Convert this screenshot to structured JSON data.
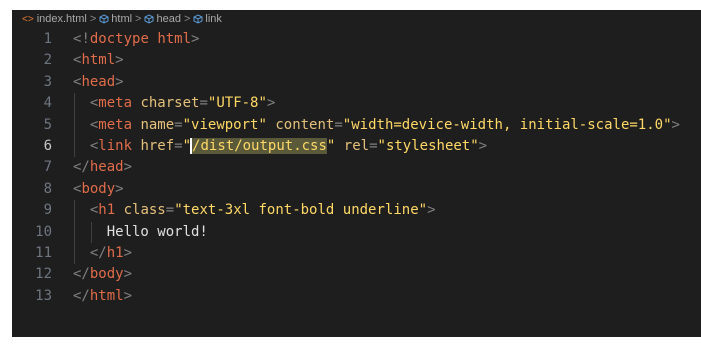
{
  "breadcrumb": {
    "items": [
      "index.html",
      "html",
      "head",
      "link"
    ],
    "separator": ">"
  },
  "editor": {
    "active_line": 6,
    "lines": [
      {
        "n": "1",
        "tokens": [
          [
            "pun",
            "<"
          ],
          [
            "pun",
            "!"
          ],
          [
            "tagname",
            "doctype"
          ],
          [
            "txt",
            " "
          ],
          [
            "tagname",
            "html"
          ],
          [
            "pun",
            ">"
          ]
        ]
      },
      {
        "n": "2",
        "tokens": [
          [
            "pun",
            "<"
          ],
          [
            "tagname",
            "html"
          ],
          [
            "pun",
            ">"
          ]
        ]
      },
      {
        "n": "3",
        "tokens": [
          [
            "pun",
            "<"
          ],
          [
            "tagname",
            "head"
          ],
          [
            "pun",
            ">"
          ]
        ]
      },
      {
        "n": "4",
        "tokens": [
          [
            "txt",
            "  "
          ],
          [
            "pun",
            "<"
          ],
          [
            "tagname",
            "meta"
          ],
          [
            "txt",
            " "
          ],
          [
            "attr",
            "charset"
          ],
          [
            "pun",
            "="
          ],
          [
            "str",
            "\"UTF-8\""
          ],
          [
            "pun",
            ">"
          ]
        ]
      },
      {
        "n": "5",
        "tokens": [
          [
            "txt",
            "  "
          ],
          [
            "pun",
            "<"
          ],
          [
            "tagname",
            "meta"
          ],
          [
            "txt",
            " "
          ],
          [
            "attr",
            "name"
          ],
          [
            "pun",
            "="
          ],
          [
            "str",
            "\"viewport\""
          ],
          [
            "txt",
            " "
          ],
          [
            "attr",
            "content"
          ],
          [
            "pun",
            "="
          ],
          [
            "str",
            "\"width=device-width, initial-scale=1.0\""
          ],
          [
            "pun",
            ">"
          ]
        ]
      },
      {
        "n": "6",
        "tokens": [
          [
            "txt",
            "  "
          ],
          [
            "pun",
            "<"
          ],
          [
            "tagname",
            "link"
          ],
          [
            "txt",
            " "
          ],
          [
            "attr",
            "href"
          ],
          [
            "pun",
            "="
          ],
          [
            "str",
            "\""
          ],
          [
            "sel",
            "/dist/output.css"
          ],
          [
            "str",
            "\""
          ],
          [
            "txt",
            " "
          ],
          [
            "attr",
            "rel"
          ],
          [
            "pun",
            "="
          ],
          [
            "str",
            "\"stylesheet\""
          ],
          [
            "pun",
            ">"
          ]
        ]
      },
      {
        "n": "7",
        "tokens": [
          [
            "pun",
            "</"
          ],
          [
            "tagname",
            "head"
          ],
          [
            "pun",
            ">"
          ]
        ]
      },
      {
        "n": "8",
        "tokens": [
          [
            "pun",
            "<"
          ],
          [
            "tagname",
            "body"
          ],
          [
            "pun",
            ">"
          ]
        ]
      },
      {
        "n": "9",
        "tokens": [
          [
            "txt",
            "  "
          ],
          [
            "pun",
            "<"
          ],
          [
            "tagname",
            "h1"
          ],
          [
            "txt",
            " "
          ],
          [
            "attr",
            "class"
          ],
          [
            "pun",
            "="
          ],
          [
            "str",
            "\"text-3xl font-bold underline\""
          ],
          [
            "pun",
            ">"
          ]
        ]
      },
      {
        "n": "10",
        "tokens": [
          [
            "txt",
            "    Hello world!"
          ]
        ]
      },
      {
        "n": "11",
        "tokens": [
          [
            "txt",
            "  "
          ],
          [
            "pun",
            "</"
          ],
          [
            "tagname",
            "h1"
          ],
          [
            "pun",
            ">"
          ]
        ]
      },
      {
        "n": "12",
        "tokens": [
          [
            "pun",
            "</"
          ],
          [
            "tagname",
            "body"
          ],
          [
            "pun",
            ">"
          ]
        ]
      },
      {
        "n": "13",
        "tokens": [
          [
            "pun",
            "</"
          ],
          [
            "tagname",
            "html"
          ],
          [
            "pun",
            ">"
          ]
        ]
      }
    ]
  },
  "colors": {
    "background": "#1e1e1e",
    "tag_name": "#e06c4a",
    "attribute": "#e5c07b",
    "string": "#ffd866",
    "punctuation": "#808080",
    "selection": "#5a5a3a"
  },
  "icons": {
    "file": "html-file-icon",
    "node": "cube-icon"
  }
}
